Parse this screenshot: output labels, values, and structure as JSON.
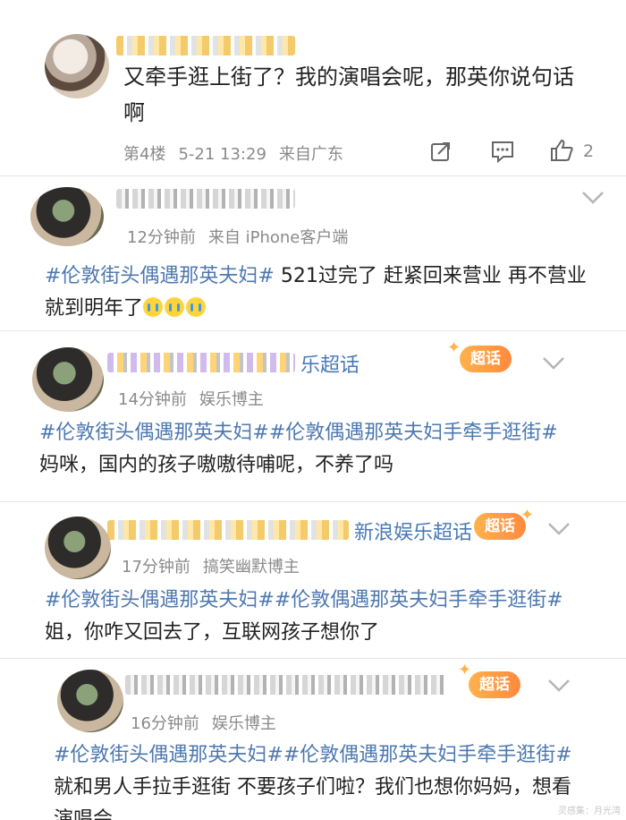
{
  "top_comment": {
    "text": "又牵手逛上街了？我的演唱会呢，那英你说句话啊",
    "floor": "第4楼",
    "date": "5-21 13:29",
    "from": "来自广东",
    "like_count": "2"
  },
  "posts": [
    {
      "time": "12分钟前",
      "source": "来自 iPhone客户端",
      "tag": "#伦敦街头偶遇那英夫妇#",
      "text": " 521过完了 赶紧回来营业 再不营业 就到明年了",
      "emoji_count": 3
    },
    {
      "name_tail": "乐超话",
      "badge": "超话",
      "time": "14分钟前",
      "source": "娱乐博主",
      "tag": "#伦敦街头偶遇那英夫妇##伦敦偶遇那英夫妇手牵手逛街#",
      "text": "妈咪，国内的孩子嗷嗷待哺呢，不养了吗"
    },
    {
      "name_tail": "新浪娱乐超话",
      "badge": "超话",
      "time": "17分钟前",
      "source": "搞笑幽默博主",
      "tag": "#伦敦街头偶遇那英夫妇##伦敦偶遇那英夫妇手牵手逛街#",
      "text": "姐，你咋又回去了，互联网孩子想你了"
    },
    {
      "badge": "超话",
      "time": "16分钟前",
      "source": "娱乐博主",
      "tag": "#伦敦街头偶遇那英夫妇##伦敦偶遇那英夫妇手牵手逛街#",
      "text": "就和男人手拉手逛街 不要孩子们啦？我们也想你妈妈，想看演唱会"
    }
  ],
  "watermark": "灵感集：月光湾"
}
